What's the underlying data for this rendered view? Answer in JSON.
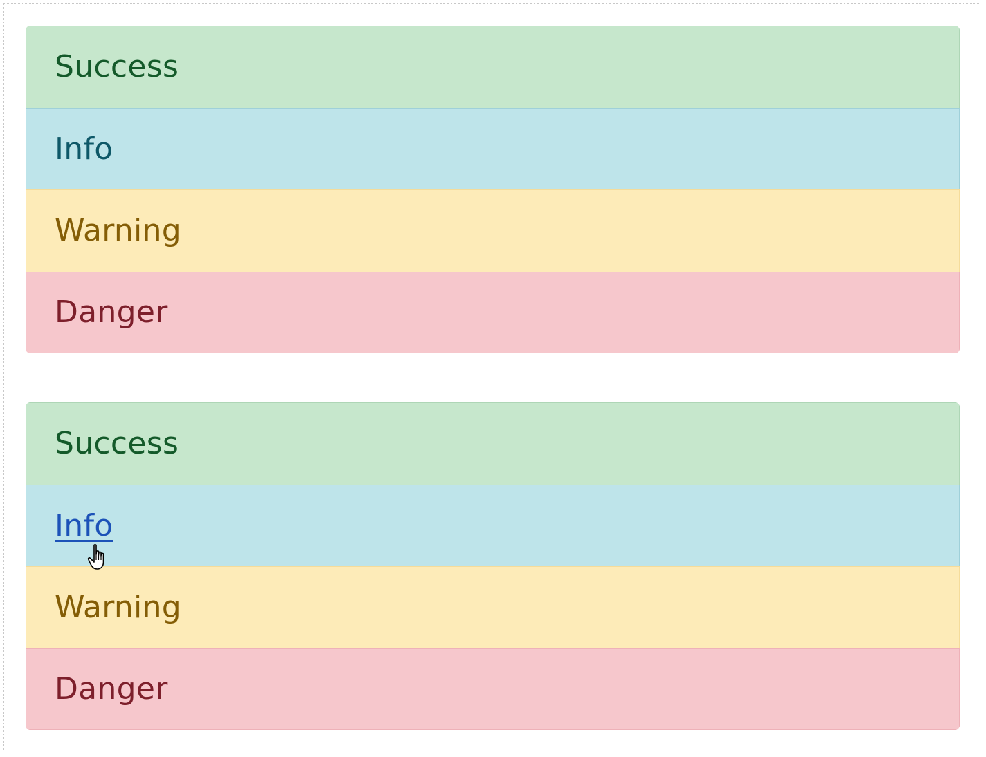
{
  "colors": {
    "success_bg": "#c6e7cc",
    "success_text": "#145a2a",
    "info_bg": "#bee4ea",
    "info_text": "#0e5868",
    "warning_bg": "#fdebb8",
    "warning_text": "#845d06",
    "danger_bg": "#f6c7cc",
    "danger_text": "#7d1f2b",
    "link": "#1c52b8"
  },
  "group1": {
    "items": [
      {
        "label": "Success"
      },
      {
        "label": "Info"
      },
      {
        "label": "Warning"
      },
      {
        "label": "Danger"
      }
    ]
  },
  "group2": {
    "items": [
      {
        "label": "Success"
      },
      {
        "label": "Info"
      },
      {
        "label": "Warning"
      },
      {
        "label": "Danger"
      }
    ]
  },
  "cursor": {
    "icon": "hand-pointer-icon"
  }
}
